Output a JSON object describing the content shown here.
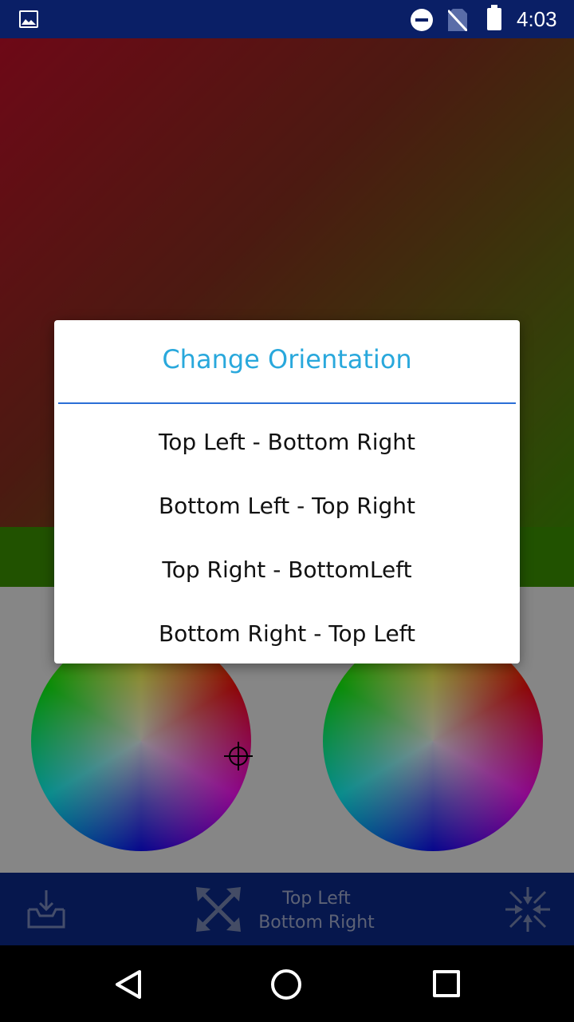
{
  "status_bar": {
    "time": "4:03"
  },
  "dialog": {
    "title": "Change Orientation",
    "options": [
      "Top Left - Bottom Right",
      "Bottom Left - Top Right",
      "Top Right - BottomLeft",
      "Bottom Right - Top Left"
    ]
  },
  "toolbar": {
    "orientation_line1": "Top Left",
    "orientation_line2": "Bottom Right"
  },
  "colors": {
    "status_bar_bg": "#0a1f66",
    "toolbar_bg": "#0b2a8c",
    "dialog_title": "#29a8dc",
    "divider": "#2b6fd6"
  },
  "icons": [
    "image-icon",
    "dnd-icon",
    "no-sim-icon",
    "battery-icon",
    "save-tray-icon",
    "expand-arrows-icon",
    "collapse-arrows-icon",
    "back-icon",
    "home-icon",
    "recent-apps-icon",
    "crosshair-icon"
  ]
}
